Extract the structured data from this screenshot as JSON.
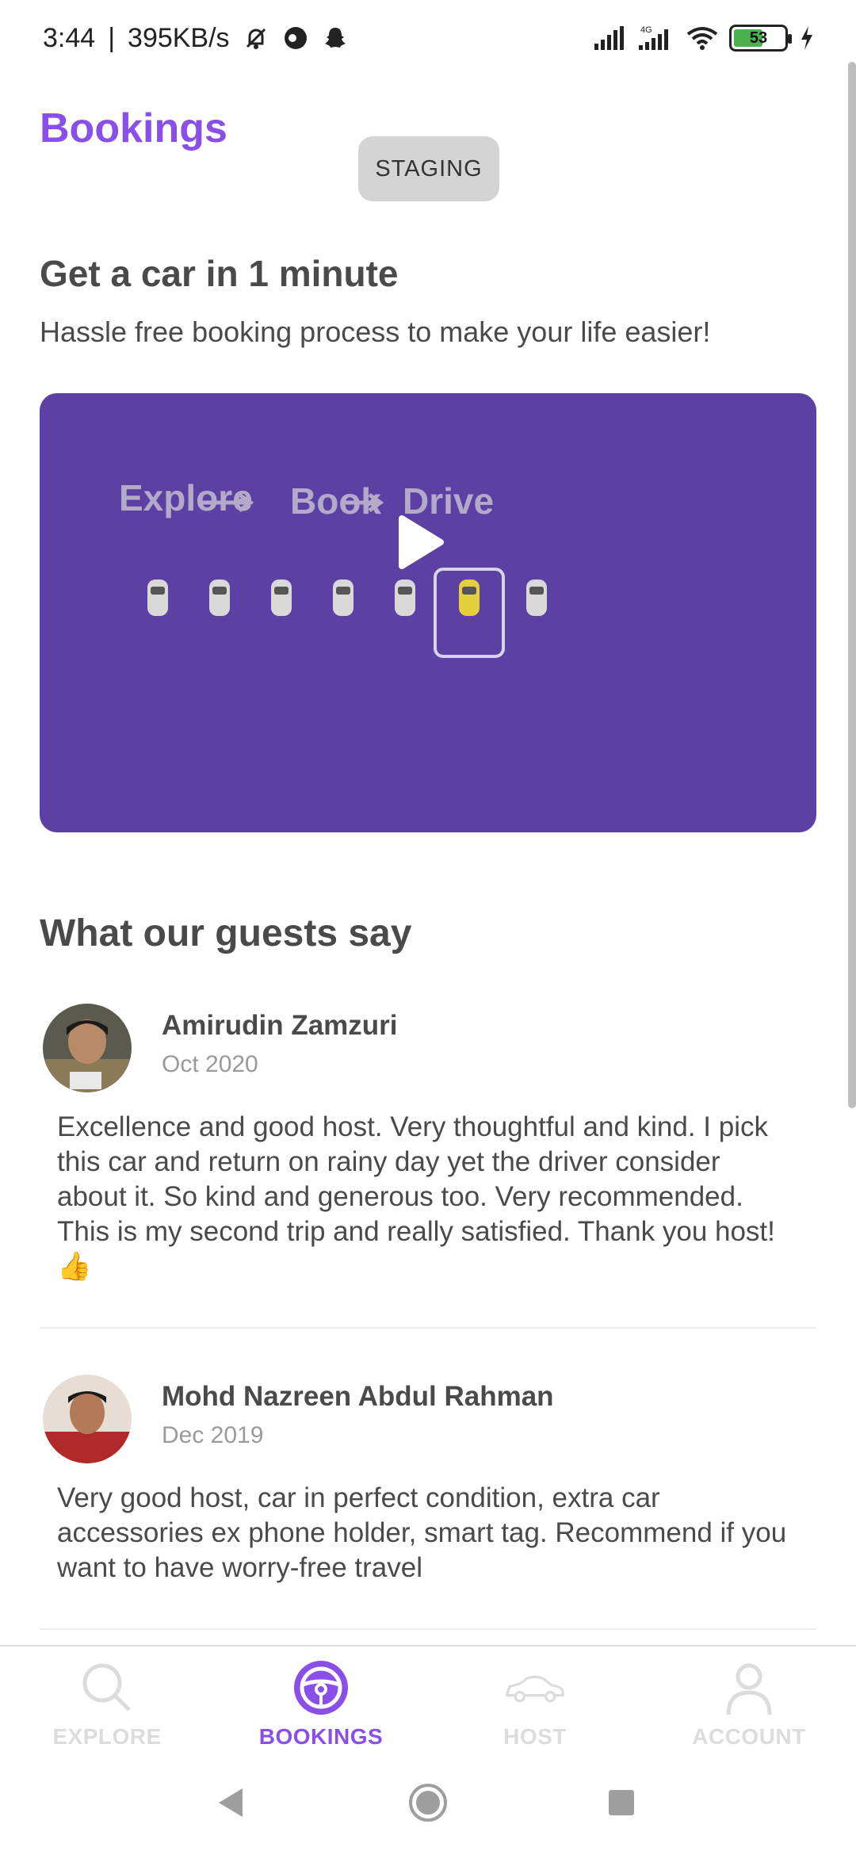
{
  "status_bar": {
    "time": "3:44",
    "network_speed": "395KB/s",
    "battery": "53",
    "colors": {
      "battery_fill": "#4caf50"
    }
  },
  "header": {
    "title": "Bookings",
    "staging_label": "STAGING"
  },
  "hero": {
    "title": "Get a car in 1 minute",
    "subtitle": "Hassle free booking process to make your life easier!"
  },
  "video": {
    "step1": "Explore",
    "step2": "Book",
    "step3": "Drive",
    "colors": {
      "background": "#5d40a3",
      "highlight_car": "#e3d03a"
    }
  },
  "reviews_section": {
    "title": "What our guests say",
    "reviews": [
      {
        "name": "Amirudin Zamzuri",
        "date": "Oct 2020",
        "text": "Excellence and good host. Very thoughtful and kind. I pick this car and return on rainy day yet the driver consider about it. So kind and generous too. Very recommended. This is my second trip and really satisfied. Thank you host!👍"
      },
      {
        "name": "Mohd Nazreen Abdul Rahman",
        "date": "Dec 2019",
        "text": "Very good host, car in perfect condition, extra car accessories ex phone holder, smart tag. Recommend if you want to have worry-free travel"
      }
    ]
  },
  "bottom_nav": {
    "items": [
      {
        "label": "EXPLORE",
        "icon": "search-icon",
        "active": false
      },
      {
        "label": "BOOKINGS",
        "icon": "steering-wheel-icon",
        "active": true
      },
      {
        "label": "HOST",
        "icon": "car-outline-icon",
        "active": false
      },
      {
        "label": "ACCOUNT",
        "icon": "person-icon",
        "active": false
      }
    ],
    "colors": {
      "active": "#8a4fe8",
      "inactive": "#dcdcdc"
    }
  }
}
